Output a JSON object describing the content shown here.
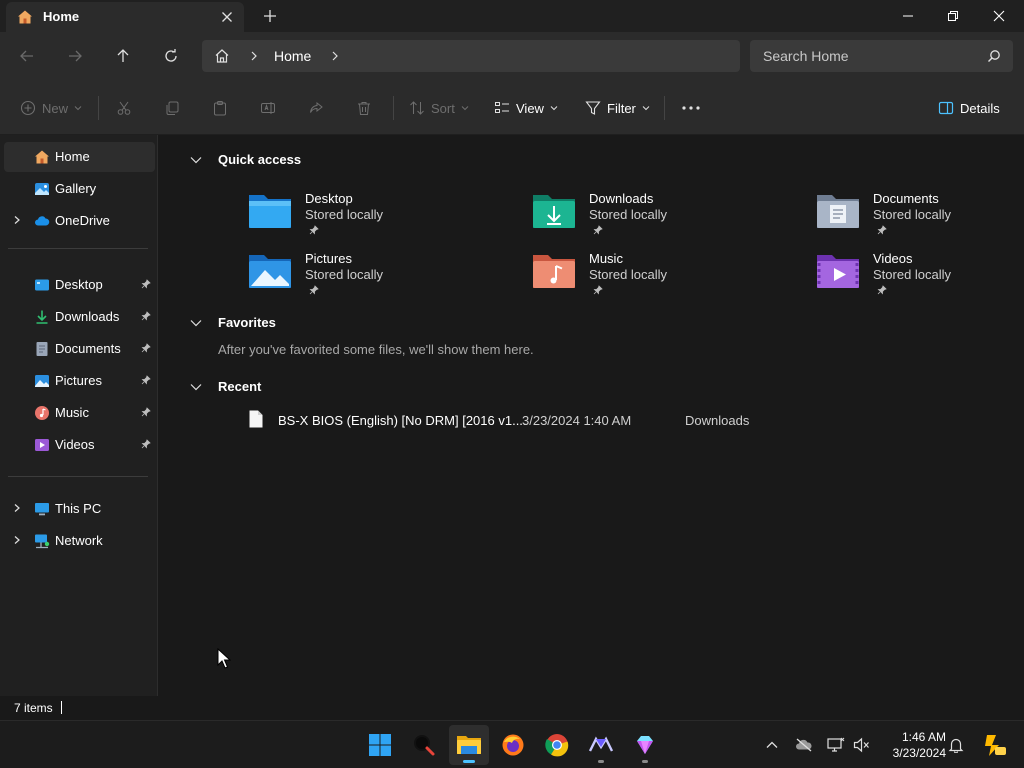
{
  "window": {
    "tab_title": "Home",
    "tab_icon": "home-icon",
    "controls": [
      "minimize-icon",
      "restore-icon",
      "close-icon"
    ]
  },
  "address_bar": {
    "breadcrumb": "Home",
    "search_placeholder": "Search Home"
  },
  "command_bar": {
    "new_label": "New",
    "sort_label": "Sort",
    "view_label": "View",
    "filter_label": "Filter",
    "details_label": "Details"
  },
  "sidebar": {
    "top": [
      {
        "label": "Home",
        "icon": "home-icon",
        "active": true
      },
      {
        "label": "Gallery",
        "icon": "gallery-icon"
      },
      {
        "label": "OneDrive",
        "icon": "cloud-icon"
      }
    ],
    "pinned": [
      {
        "label": "Desktop",
        "icon": "desktop-folder-icon"
      },
      {
        "label": "Downloads",
        "icon": "download-icon"
      },
      {
        "label": "Documents",
        "icon": "documents-icon"
      },
      {
        "label": "Pictures",
        "icon": "pictures-icon"
      },
      {
        "label": "Music",
        "icon": "music-icon"
      },
      {
        "label": "Videos",
        "icon": "videos-icon"
      }
    ],
    "devices": [
      {
        "label": "This PC",
        "icon": "pc-icon"
      },
      {
        "label": "Network",
        "icon": "network-icon"
      }
    ]
  },
  "quick_access": {
    "title": "Quick access",
    "items": [
      {
        "name": "Desktop",
        "subtitle": "Stored locally",
        "color": "#1e90e8"
      },
      {
        "name": "Downloads",
        "subtitle": "Stored locally",
        "color": "#1aab8a"
      },
      {
        "name": "Documents",
        "subtitle": "Stored locally",
        "color": "#8c9bb0"
      },
      {
        "name": "Pictures",
        "subtitle": "Stored locally",
        "color": "#2b8fe0"
      },
      {
        "name": "Music",
        "subtitle": "Stored locally",
        "color": "#e8746a"
      },
      {
        "name": "Videos",
        "subtitle": "Stored locally",
        "color": "#9b59d6"
      }
    ]
  },
  "favorites": {
    "title": "Favorites",
    "empty_message": "After you've favorited some files, we'll show them here."
  },
  "recent": {
    "title": "Recent",
    "items": [
      {
        "name": "BS-X BIOS (English) [No DRM] [2016 v1....",
        "date": "3/23/2024 1:40 AM",
        "location": "Downloads"
      }
    ]
  },
  "status_bar": {
    "item_count": "7 items"
  },
  "taskbar": {
    "apps": [
      "windows-start-icon",
      "search-icon",
      "file-explorer-icon",
      "firefox-icon",
      "chrome-icon",
      "app-icon",
      "gem-app-icon"
    ],
    "time": "1:46 AM",
    "date": "3/23/2024"
  }
}
